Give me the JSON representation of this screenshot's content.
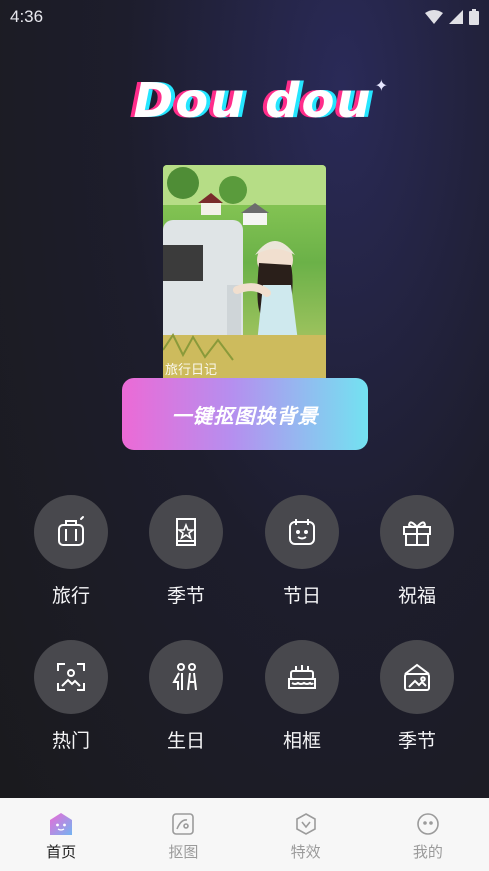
{
  "status": {
    "time": "4:36"
  },
  "logo": {
    "text": "Dou dou"
  },
  "photo": {
    "caption": "旅行日记"
  },
  "cta": {
    "label": "一键抠图换背景"
  },
  "categories": [
    {
      "label": "旅行",
      "icon": "suitcase-icon"
    },
    {
      "label": "季节",
      "icon": "book-star-icon"
    },
    {
      "label": "节日",
      "icon": "calendar-face-icon"
    },
    {
      "label": "祝福",
      "icon": "gift-icon"
    },
    {
      "label": "热门",
      "icon": "scan-image-icon"
    },
    {
      "label": "生日",
      "icon": "people-icon"
    },
    {
      "label": "相框",
      "icon": "cake-icon"
    },
    {
      "label": "季节",
      "icon": "frame-landscape-icon"
    }
  ],
  "nav": {
    "tabs": [
      {
        "label": "首页",
        "icon": "home-icon",
        "active": true
      },
      {
        "label": "抠图",
        "icon": "cutout-icon",
        "active": false
      },
      {
        "label": "特效",
        "icon": "effects-icon",
        "active": false
      },
      {
        "label": "我的",
        "icon": "profile-icon",
        "active": false
      }
    ]
  },
  "colors": {
    "accent_pink": "#ec6ad6",
    "accent_cyan": "#73e2f1",
    "circle_bg": "#48484d",
    "nav_bg": "#f7f7f7"
  }
}
